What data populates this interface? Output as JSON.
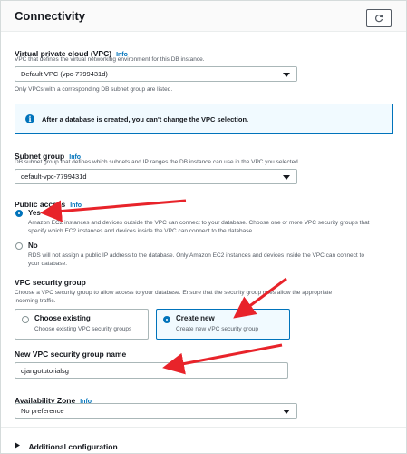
{
  "header": {
    "title": "Connectivity",
    "refresh_icon": "refresh-icon"
  },
  "vpc": {
    "label": "Virtual private cloud (VPC)",
    "info": "Info",
    "description": "VPC that defines the virtual networking environment for this DB instance.",
    "selected": "Default VPC (vpc-7799431d)",
    "hint": "Only VPCs with a corresponding DB subnet group are listed."
  },
  "alert": {
    "text": "After a database is created, you can't change the VPC selection."
  },
  "subnet": {
    "label": "Subnet group",
    "info": "Info",
    "description": "DB subnet group that defines which subnets and IP ranges the DB instance can use in the VPC you selected.",
    "selected": "default-vpc-7799431d"
  },
  "public_access": {
    "label": "Public access",
    "info": "Info",
    "yes_label": "Yes",
    "yes_desc_1": "Amazon EC2 instances and devices outside the VPC can connect to your database. Choose one or more VPC security groups that",
    "yes_desc_2": "specify which EC2 instances and devices inside the VPC can connect to the database.",
    "no_label": "No",
    "no_desc_1": "RDS will not assign a public IP address to the database. Only Amazon EC2 instances and devices inside the VPC can connect to",
    "no_desc_2": "your database."
  },
  "security_group": {
    "label": "VPC security group",
    "description_1": "Choose a VPC security group to allow access to your database. Ensure that the security group rules allow the appropriate",
    "description_2": "incoming traffic.",
    "existing_title": "Choose existing",
    "existing_desc": "Choose existing VPC security groups",
    "new_title": "Create new",
    "new_desc": "Create new VPC security group"
  },
  "new_sg_name": {
    "label": "New VPC security group name",
    "value": "djangotutorialsg"
  },
  "availability_zone": {
    "label": "Availability Zone",
    "info": "Info",
    "selected": "No preference"
  },
  "additional": {
    "label": "Additional configuration"
  },
  "colors": {
    "accent": "#0073bb",
    "annotation_arrow": "#e8232a"
  }
}
